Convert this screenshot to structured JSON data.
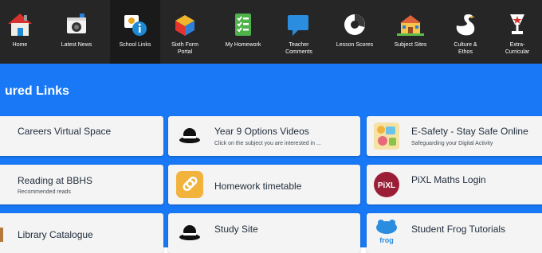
{
  "nav": {
    "items": [
      {
        "label": "Home",
        "icon": "house-icon"
      },
      {
        "label": "Latest News",
        "icon": "camera-icon"
      },
      {
        "label": "School Links",
        "icon": "info-icon"
      },
      {
        "label": "Sixth Form\nPortal",
        "icon": "cube-icon"
      },
      {
        "label": "My Homework",
        "icon": "checklist-icon"
      },
      {
        "label": "Teacher\nComments",
        "icon": "speech-bubble-icon"
      },
      {
        "label": "Lesson Scores",
        "icon": "scores-icon"
      },
      {
        "label": "Subject Sites",
        "icon": "school-building-icon"
      },
      {
        "label": "Culture &\nEthos",
        "icon": "swan-icon"
      },
      {
        "label": "Extra-\nCurricular",
        "icon": "trophy-icon"
      }
    ],
    "active_index": 2,
    "background": "#262626"
  },
  "section": {
    "title": "ured Links",
    "background": "#1878f5"
  },
  "tiles": [
    {
      "title": "Careers Virtual Space",
      "subtitle": ""
    },
    {
      "title": "Year 9 Options Videos",
      "subtitle": "Click on the subject you are interested in ..."
    },
    {
      "title": "E-Safety - Stay Safe Online",
      "subtitle": "Safeguarding your Digital Activity"
    },
    {
      "title": "Reading at BBHS",
      "subtitle": "Recommended reads"
    },
    {
      "title": "Homework timetable",
      "subtitle": ""
    },
    {
      "title": "PiXL Maths Login",
      "subtitle": "",
      "badge": "PiXL"
    },
    {
      "title": "Library Catalogue",
      "subtitle": ""
    },
    {
      "title": "Study Site",
      "subtitle": ""
    },
    {
      "title": "Student Frog Tutorials",
      "subtitle": "",
      "badge": "frog"
    }
  ]
}
